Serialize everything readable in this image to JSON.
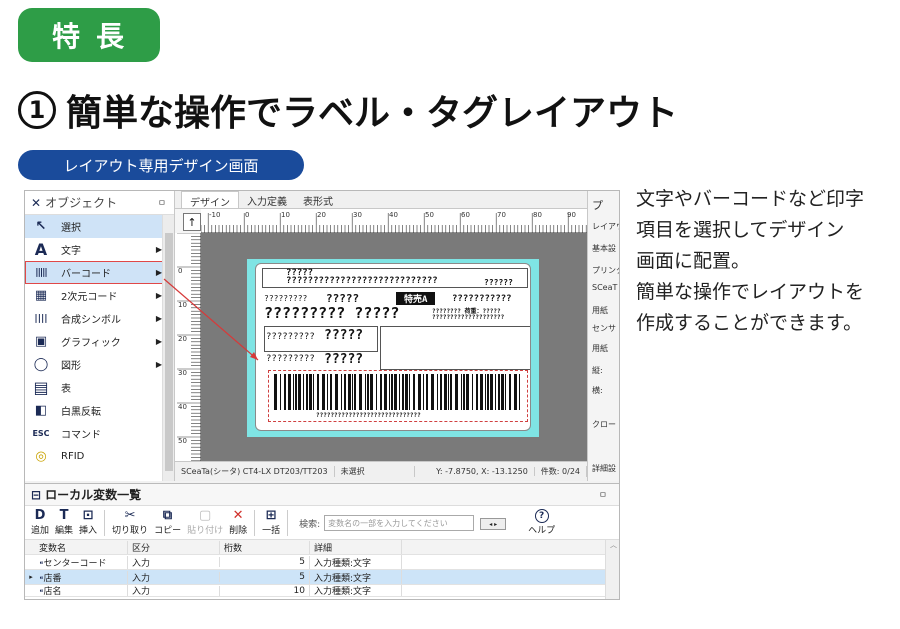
{
  "badge": "特長",
  "heading": {
    "number": "1",
    "text": "簡単な操作でラベル・タグレイアウト"
  },
  "pill": "レイアウト専用デザイン画面",
  "description": [
    "文字やバーコードなど印字",
    "項目を選択してデザイン",
    "画面に配置。",
    "簡単な操作でレイアウトを",
    "作成することができます。"
  ],
  "object_panel": {
    "title": "オブジェクト",
    "pin": "ㅁ",
    "items": [
      {
        "label": "選択",
        "icon": "↖",
        "arrow": ""
      },
      {
        "label": "文字",
        "icon": "A",
        "arrow": "▶"
      },
      {
        "label": "バーコード",
        "icon": "|||||",
        "arrow": "▶"
      },
      {
        "label": "2次元コード",
        "icon": "▦",
        "arrow": "▶"
      },
      {
        "label": "合成シンボル",
        "icon": "||||",
        "arrow": "▶"
      },
      {
        "label": "グラフィック",
        "icon": "▣",
        "arrow": "▶"
      },
      {
        "label": "図形",
        "icon": "◯",
        "arrow": "▶"
      },
      {
        "label": "表",
        "icon": "▤",
        "arrow": ""
      },
      {
        "label": "白黒反転",
        "icon": "◧",
        "arrow": ""
      },
      {
        "label": "コマンド",
        "icon": "ESC",
        "arrow": ""
      },
      {
        "label": "RFID",
        "icon": "◎",
        "arrow": ""
      }
    ]
  },
  "design_tabs": [
    "デザイン",
    "入力定義",
    "表形式"
  ],
  "ruler_h": [
    "-10",
    "0",
    "10",
    "20",
    "30",
    "40",
    "50",
    "60",
    "70",
    "80",
    "90"
  ],
  "ruler_v": [
    "0",
    "10",
    "20",
    "30",
    "40",
    "50"
  ],
  "label_content": {
    "t1": "?????",
    "t2": "????????????????????????????",
    "t3": "??????",
    "t4": "?????????",
    "t5": "?????",
    "t6": "特売A",
    "t7": "???????????",
    "t8": "????????? ?????",
    "t9": "???????? 荷重：?????",
    "t10": "????????????????????",
    "t11": "?????????",
    "t12": "?????",
    "t13": "?????????",
    "t14": "?????",
    "t15": "?????????????????????????????"
  },
  "status": {
    "printer": "SCeaTa(シータ) CT4-LX DT203/TT203",
    "selection": "未選択",
    "coords": "Y: -7.8750, X: -13.1250",
    "count": "件数: 0/24"
  },
  "prop_panel": [
    "プ",
    "レイアウ",
    "基本設",
    "プリンタ",
    "SCeaT",
    "用紙",
    "センサ",
    "用紙",
    "縦:",
    "横:",
    "クロー",
    "詳細設"
  ],
  "var_panel": {
    "title": "ローカル変数一覧",
    "pin": "ㅁ",
    "toolbar": [
      {
        "label": "追加",
        "icon": "D"
      },
      {
        "label": "編集",
        "icon": "T"
      },
      {
        "label": "挿入",
        "icon": "⊡"
      },
      {
        "label": "切り取り",
        "icon": "✂"
      },
      {
        "label": "コピー",
        "icon": "⧉"
      },
      {
        "label": "貼り付け",
        "icon": "▢"
      },
      {
        "label": "削除",
        "icon": "✕"
      },
      {
        "label": "一括",
        "icon": "⊞"
      },
      {
        "label": "ヘルプ",
        "icon": "?"
      }
    ],
    "search_label": "検索:",
    "search_placeholder": "変数名の一部を入力してください",
    "search_buttons": "◂ ▸",
    "columns": [
      "変数名",
      "区分",
      "桁数",
      "詳細"
    ],
    "rows": [
      {
        "marker": "",
        "name": "センターコード",
        "type": "入力",
        "digits": "5",
        "detail": "入力種類:文字"
      },
      {
        "marker": "▸",
        "name": "店番",
        "type": "入力",
        "digits": "5",
        "detail": "入力種類:文字"
      },
      {
        "marker": "",
        "name": "店名",
        "type": "入力",
        "digits": "10",
        "detail": "入力種類:文字"
      }
    ]
  }
}
